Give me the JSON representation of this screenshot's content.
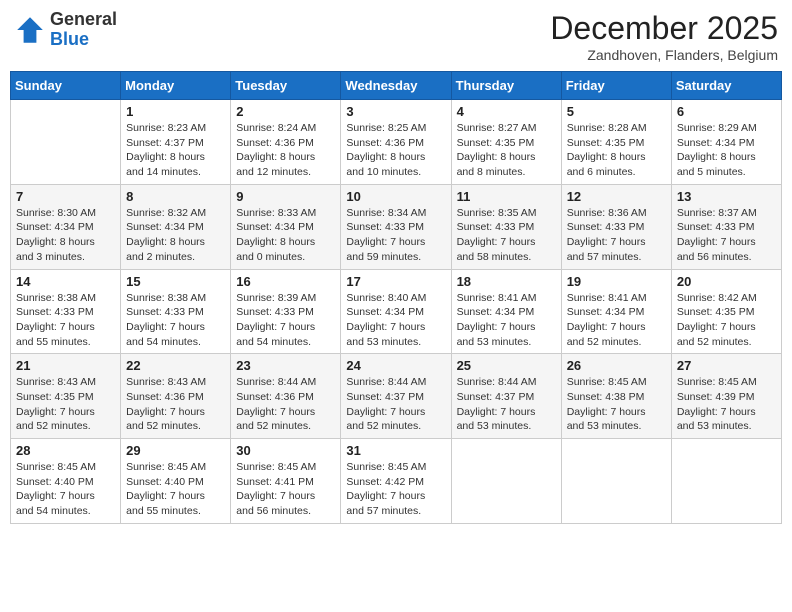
{
  "logo": {
    "general": "General",
    "blue": "Blue"
  },
  "header": {
    "month": "December 2025",
    "location": "Zandhoven, Flanders, Belgium"
  },
  "weekdays": [
    "Sunday",
    "Monday",
    "Tuesday",
    "Wednesday",
    "Thursday",
    "Friday",
    "Saturday"
  ],
  "weeks": [
    [
      {
        "day": "",
        "info": ""
      },
      {
        "day": "1",
        "info": "Sunrise: 8:23 AM\nSunset: 4:37 PM\nDaylight: 8 hours\nand 14 minutes."
      },
      {
        "day": "2",
        "info": "Sunrise: 8:24 AM\nSunset: 4:36 PM\nDaylight: 8 hours\nand 12 minutes."
      },
      {
        "day": "3",
        "info": "Sunrise: 8:25 AM\nSunset: 4:36 PM\nDaylight: 8 hours\nand 10 minutes."
      },
      {
        "day": "4",
        "info": "Sunrise: 8:27 AM\nSunset: 4:35 PM\nDaylight: 8 hours\nand 8 minutes."
      },
      {
        "day": "5",
        "info": "Sunrise: 8:28 AM\nSunset: 4:35 PM\nDaylight: 8 hours\nand 6 minutes."
      },
      {
        "day": "6",
        "info": "Sunrise: 8:29 AM\nSunset: 4:34 PM\nDaylight: 8 hours\nand 5 minutes."
      }
    ],
    [
      {
        "day": "7",
        "info": "Sunrise: 8:30 AM\nSunset: 4:34 PM\nDaylight: 8 hours\nand 3 minutes."
      },
      {
        "day": "8",
        "info": "Sunrise: 8:32 AM\nSunset: 4:34 PM\nDaylight: 8 hours\nand 2 minutes."
      },
      {
        "day": "9",
        "info": "Sunrise: 8:33 AM\nSunset: 4:34 PM\nDaylight: 8 hours\nand 0 minutes."
      },
      {
        "day": "10",
        "info": "Sunrise: 8:34 AM\nSunset: 4:33 PM\nDaylight: 7 hours\nand 59 minutes."
      },
      {
        "day": "11",
        "info": "Sunrise: 8:35 AM\nSunset: 4:33 PM\nDaylight: 7 hours\nand 58 minutes."
      },
      {
        "day": "12",
        "info": "Sunrise: 8:36 AM\nSunset: 4:33 PM\nDaylight: 7 hours\nand 57 minutes."
      },
      {
        "day": "13",
        "info": "Sunrise: 8:37 AM\nSunset: 4:33 PM\nDaylight: 7 hours\nand 56 minutes."
      }
    ],
    [
      {
        "day": "14",
        "info": "Sunrise: 8:38 AM\nSunset: 4:33 PM\nDaylight: 7 hours\nand 55 minutes."
      },
      {
        "day": "15",
        "info": "Sunrise: 8:38 AM\nSunset: 4:33 PM\nDaylight: 7 hours\nand 54 minutes."
      },
      {
        "day": "16",
        "info": "Sunrise: 8:39 AM\nSunset: 4:33 PM\nDaylight: 7 hours\nand 54 minutes."
      },
      {
        "day": "17",
        "info": "Sunrise: 8:40 AM\nSunset: 4:34 PM\nDaylight: 7 hours\nand 53 minutes."
      },
      {
        "day": "18",
        "info": "Sunrise: 8:41 AM\nSunset: 4:34 PM\nDaylight: 7 hours\nand 53 minutes."
      },
      {
        "day": "19",
        "info": "Sunrise: 8:41 AM\nSunset: 4:34 PM\nDaylight: 7 hours\nand 52 minutes."
      },
      {
        "day": "20",
        "info": "Sunrise: 8:42 AM\nSunset: 4:35 PM\nDaylight: 7 hours\nand 52 minutes."
      }
    ],
    [
      {
        "day": "21",
        "info": "Sunrise: 8:43 AM\nSunset: 4:35 PM\nDaylight: 7 hours\nand 52 minutes."
      },
      {
        "day": "22",
        "info": "Sunrise: 8:43 AM\nSunset: 4:36 PM\nDaylight: 7 hours\nand 52 minutes."
      },
      {
        "day": "23",
        "info": "Sunrise: 8:44 AM\nSunset: 4:36 PM\nDaylight: 7 hours\nand 52 minutes."
      },
      {
        "day": "24",
        "info": "Sunrise: 8:44 AM\nSunset: 4:37 PM\nDaylight: 7 hours\nand 52 minutes."
      },
      {
        "day": "25",
        "info": "Sunrise: 8:44 AM\nSunset: 4:37 PM\nDaylight: 7 hours\nand 53 minutes."
      },
      {
        "day": "26",
        "info": "Sunrise: 8:45 AM\nSunset: 4:38 PM\nDaylight: 7 hours\nand 53 minutes."
      },
      {
        "day": "27",
        "info": "Sunrise: 8:45 AM\nSunset: 4:39 PM\nDaylight: 7 hours\nand 53 minutes."
      }
    ],
    [
      {
        "day": "28",
        "info": "Sunrise: 8:45 AM\nSunset: 4:40 PM\nDaylight: 7 hours\nand 54 minutes."
      },
      {
        "day": "29",
        "info": "Sunrise: 8:45 AM\nSunset: 4:40 PM\nDaylight: 7 hours\nand 55 minutes."
      },
      {
        "day": "30",
        "info": "Sunrise: 8:45 AM\nSunset: 4:41 PM\nDaylight: 7 hours\nand 56 minutes."
      },
      {
        "day": "31",
        "info": "Sunrise: 8:45 AM\nSunset: 4:42 PM\nDaylight: 7 hours\nand 57 minutes."
      },
      {
        "day": "",
        "info": ""
      },
      {
        "day": "",
        "info": ""
      },
      {
        "day": "",
        "info": ""
      }
    ]
  ]
}
